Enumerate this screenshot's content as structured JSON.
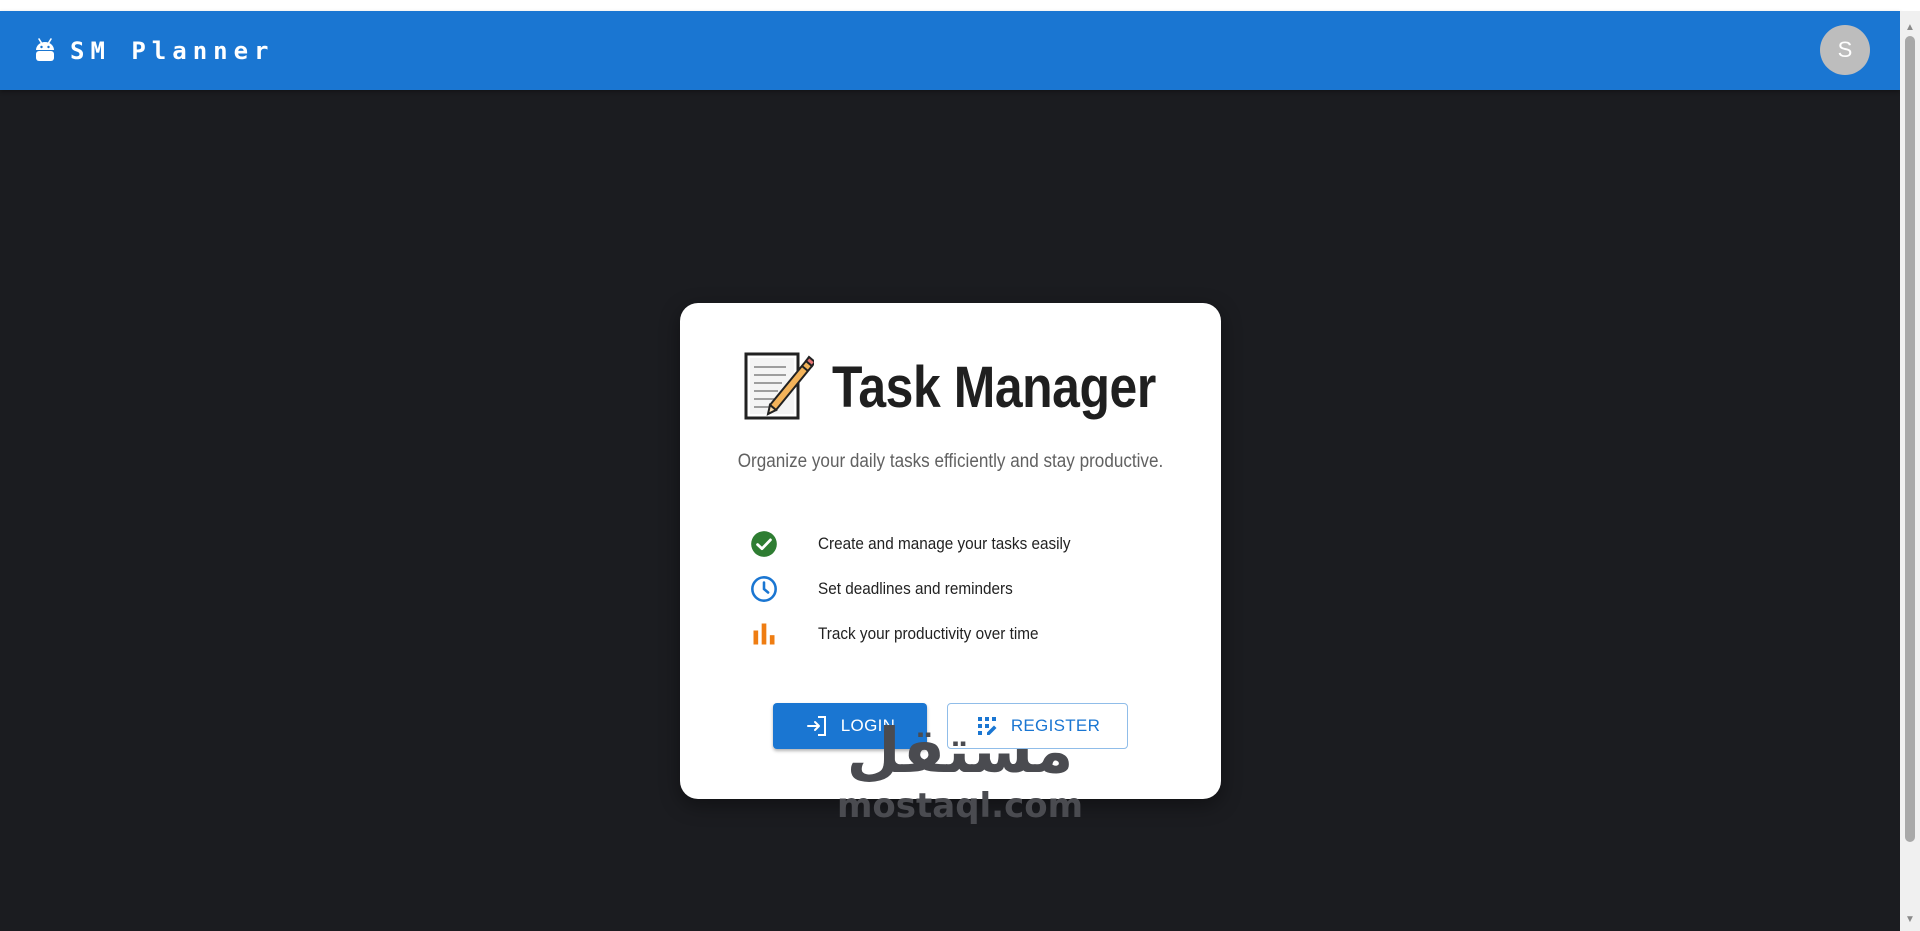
{
  "appbar": {
    "brand_icon": "android-icon",
    "brand_name": "SM Planner",
    "avatar_initial": "S",
    "color": "#1a76d2"
  },
  "card": {
    "title_icon": "memo-icon",
    "title": "Task Manager",
    "subtitle": "Organize your daily tasks efficiently and stay productive.",
    "features": [
      {
        "icon": "check-circle-icon",
        "color": "#2e7d32",
        "label": "Create and manage your tasks easily"
      },
      {
        "icon": "clock-icon",
        "color": "#1a76d2",
        "label": "Set deadlines and reminders"
      },
      {
        "icon": "bar-chart-icon",
        "color": "#ef7d12",
        "label": "Track your productivity over time"
      }
    ],
    "login_label": "LOGIN",
    "register_label": "REGISTER"
  },
  "watermark": {
    "arabic": "مستقل",
    "latin": "mostaql.com"
  }
}
